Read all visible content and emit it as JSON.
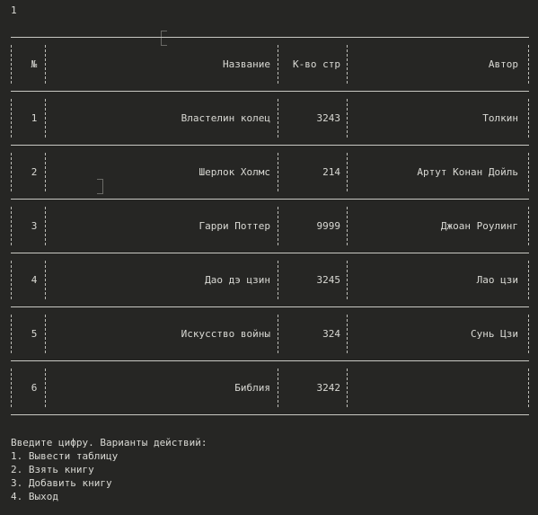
{
  "console": {
    "input_echo": "1",
    "table": {
      "headers": {
        "num": "№",
        "name": "Название",
        "pages": "К-во стр",
        "author": "Автор"
      },
      "rows": [
        {
          "num": "1",
          "name": "Властелин колец",
          "pages": "3243",
          "author": "Толкин"
        },
        {
          "num": "2",
          "name": "Шерлок Холмс",
          "pages": "214",
          "author": "Артут Конан Дойль"
        },
        {
          "num": "3",
          "name": "Гарри Поттер",
          "pages": "9999",
          "author": "Джоан Роулинг"
        },
        {
          "num": "4",
          "name": "Дао дэ цзин",
          "pages": "3245",
          "author": "Лао цзи"
        },
        {
          "num": "5",
          "name": "Искусство войны",
          "pages": "324",
          "author": "Сунь Цзи"
        },
        {
          "num": "6",
          "name": "Библия",
          "pages": "3242",
          "author": ""
        }
      ]
    },
    "menu": {
      "prompt": "Введите цифру. Варианты действий:",
      "options": [
        "1. Вывести таблицу",
        "2. Взять книгу",
        "3. Добавить книгу",
        "4. Выход"
      ]
    }
  }
}
